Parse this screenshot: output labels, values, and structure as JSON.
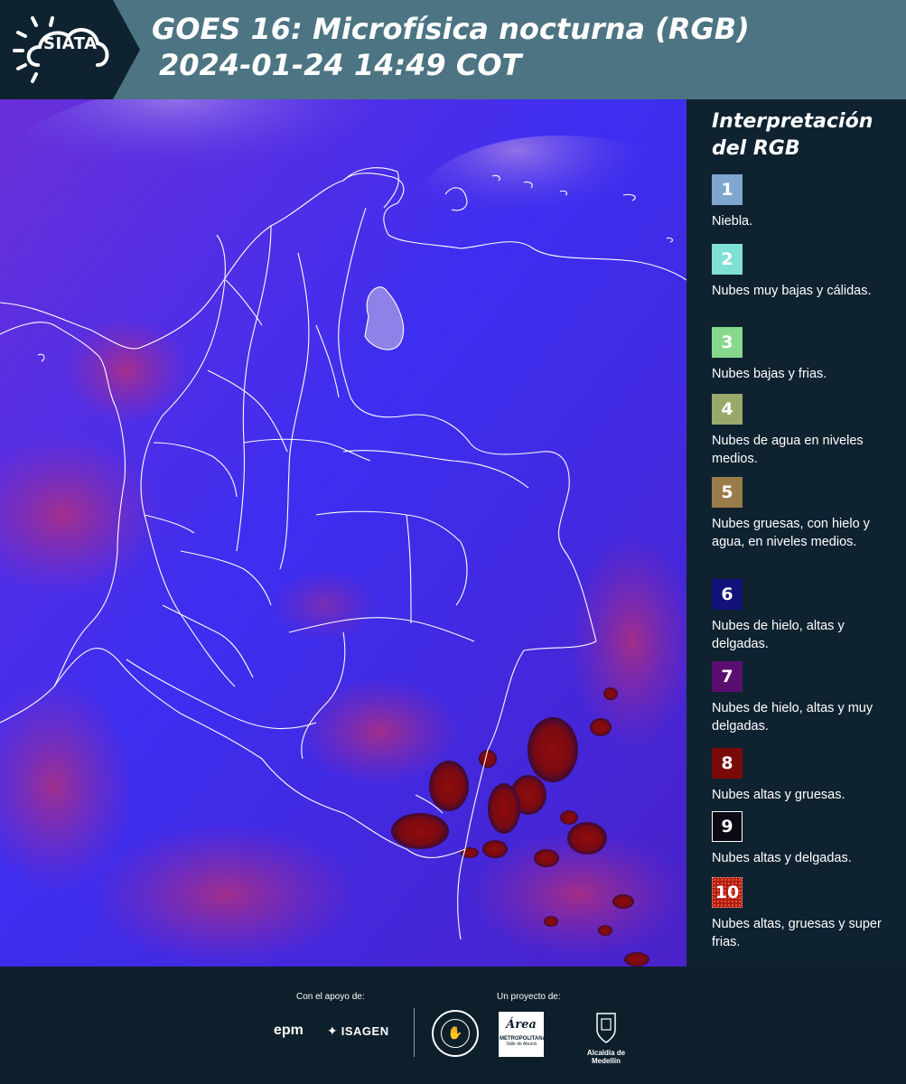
{
  "header": {
    "logo_text": "SIATA",
    "title_line1": "GOES 16: Microfísica nocturna (RGB)",
    "title_line2": "2024-01-24 14:49 COT"
  },
  "legend": {
    "title_line1": "Interpretación",
    "title_line2": "del RGB",
    "items": [
      {
        "num": "1",
        "label": "Niebla.",
        "color": "#7fa6cf"
      },
      {
        "num": "2",
        "label": "Nubes muy bajas y cálidas.",
        "color": "#7fe0d6"
      },
      {
        "num": "3",
        "label": "Nubes bajas y frias.",
        "color": "#86d98c"
      },
      {
        "num": "4",
        "label": "Nubes de agua en niveles medios.",
        "color": "#9aa86a"
      },
      {
        "num": "5",
        "label": "Nubes gruesas, con hielo y agua, en niveles medios.",
        "color": "#9a7b4a"
      },
      {
        "num": "6",
        "label": "Nubes de hielo, altas y delgadas.",
        "color": "#13127a"
      },
      {
        "num": "7",
        "label": "Nubes de hielo, altas y muy delgadas.",
        "color": "#5a0f70"
      },
      {
        "num": "8",
        "label": "Nubes altas y gruesas.",
        "color": "#7a0a0a"
      },
      {
        "num": "9",
        "label": "Nubes altas y delgadas.",
        "color": "#0a0a14"
      },
      {
        "num": "10",
        "label": "Nubes altas, gruesas y super frias.",
        "color": "#b01a10"
      }
    ]
  },
  "footer": {
    "support_label": "Con el apoyo de:",
    "project_label": "Un proyecto de:",
    "sponsor_epm": "epm",
    "sponsor_isagen": "ISAGEN",
    "sponsor_area_line1": "Área",
    "sponsor_area_line2": "METROPOLITANA",
    "sponsor_area_line3": "Valle de Aburrá",
    "sponsor_alcaldia": "Alcaldía de Medellín"
  }
}
